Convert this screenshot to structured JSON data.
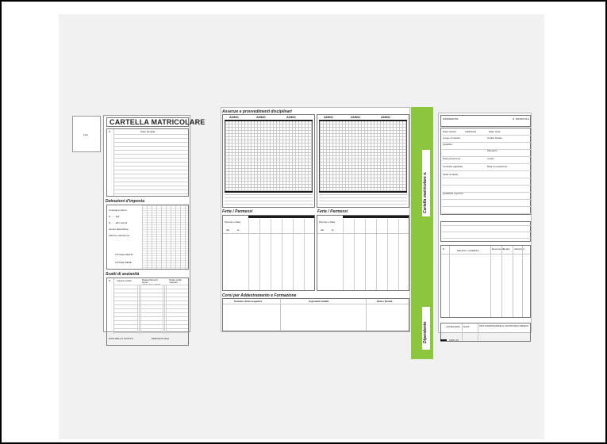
{
  "photo_label": "Foto",
  "left_sheet": {
    "title": "CARTELLA MATRICOLARE",
    "col_n": "N.",
    "col_family": "Stato famiglia",
    "deductions_title": "Detrazioni d'imposta",
    "deductions_rows": [
      "Coniuge a carico",
      "N. ..... figli",
      "N. ..... altri carichi",
      "Lavoro dipendente",
      "Ulteriore detrazione"
    ],
    "total_annual": "TOTALE ANNUO",
    "total_monthly": "TOTALE MESE",
    "seniority_title": "Scatti di anzianità",
    "seniority_cols": [
      "N.",
      "Importo scatto",
      "Riassorbimenti super-minimi/assorbibili",
      "Totale scatti maturati"
    ],
    "next_step_date": "DATA DELLO SCATTO",
    "percentage": "PERCENTUALE"
  },
  "middle_sheet": {
    "section_disciplinary": "Assenze e provvedimenti disciplinari",
    "year_label": "ANNO",
    "section_leave_left": "Ferie / Permessi",
    "section_leave_right": "Ferie / Permessi",
    "period_label": "Periodo o Data",
    "from_label": "dal",
    "to_label": "al",
    "leave_header": "FERIE",
    "leave_sub": "PERMESSI RETRIBUITI",
    "leave_extra": "PERMESSI NON RETR.",
    "courses_title": "Corsi per Addestramento e Formazione",
    "courses_cols": [
      "Società o Ente erogatore",
      "Argomenti trattati",
      "Data e Durata"
    ]
  },
  "spine": {
    "label_top": "Cartella matricolare n.",
    "label_bottom": "Dipendente"
  },
  "right_sheet": {
    "field_employee": "DIPENDENTE",
    "field_number": "N. MATRICOLA",
    "small_labels": [
      "Data nascita",
      "Via/Piazza",
      "Stato civile",
      "Luogo di nascita",
      "Codice fiscale",
      "Qualifica",
      "Mansione",
      "Livello",
      "Data assunzione",
      "Contratto applicato",
      "Data di cessazione",
      "Titolo di studio"
    ],
    "qualifications": "Qualifiche superiori",
    "tasks_title": "Mansioni / Qualifiche",
    "tasks_cols": [
      "N.",
      "Mansioni / Qualifiche",
      "Decorrenza",
      "Livello",
      "Retrib.",
      "Variazioni"
    ],
    "bottom_left": "CATEGORIA",
    "bottom_mid": "DATA",
    "bottom_right": "DATA COMUNICAZIONE AL CENTRO PER L'IMPIEGO",
    "footer_code": "CM/C 20"
  }
}
